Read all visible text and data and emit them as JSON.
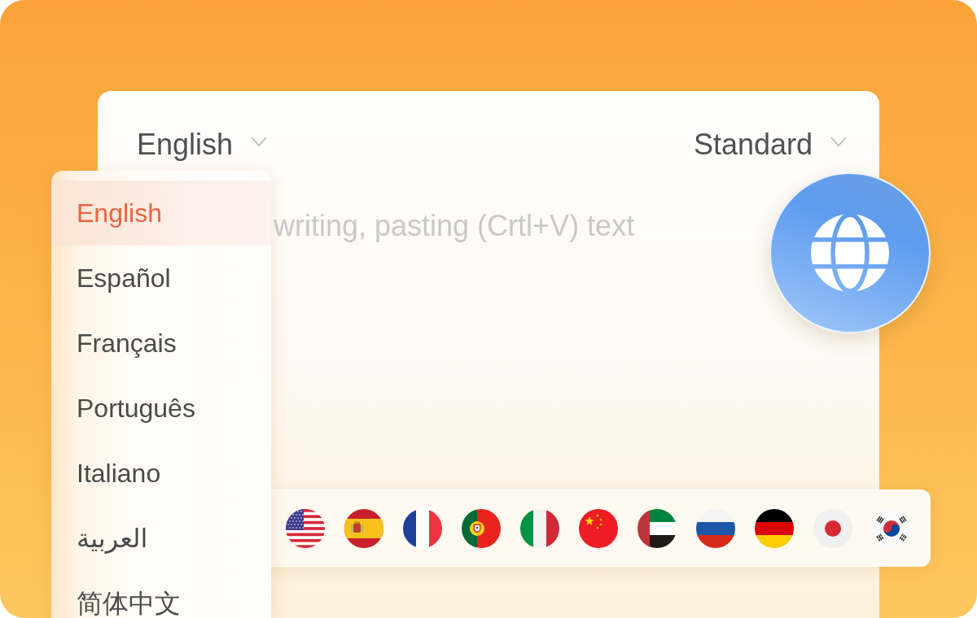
{
  "source_language": {
    "label": "English",
    "expanded": true,
    "options": [
      {
        "label": "English",
        "selected": true
      },
      {
        "label": "Español",
        "selected": false
      },
      {
        "label": "Français",
        "selected": false
      },
      {
        "label": "Português",
        "selected": false
      },
      {
        "label": "Italiano",
        "selected": false
      },
      {
        "label": "العربية",
        "selected": false
      },
      {
        "label": "简体中文",
        "selected": false
      }
    ]
  },
  "mode": {
    "label": "Standard"
  },
  "text_input": {
    "placeholder": "writing, pasting (Crtl+V) text"
  }
}
